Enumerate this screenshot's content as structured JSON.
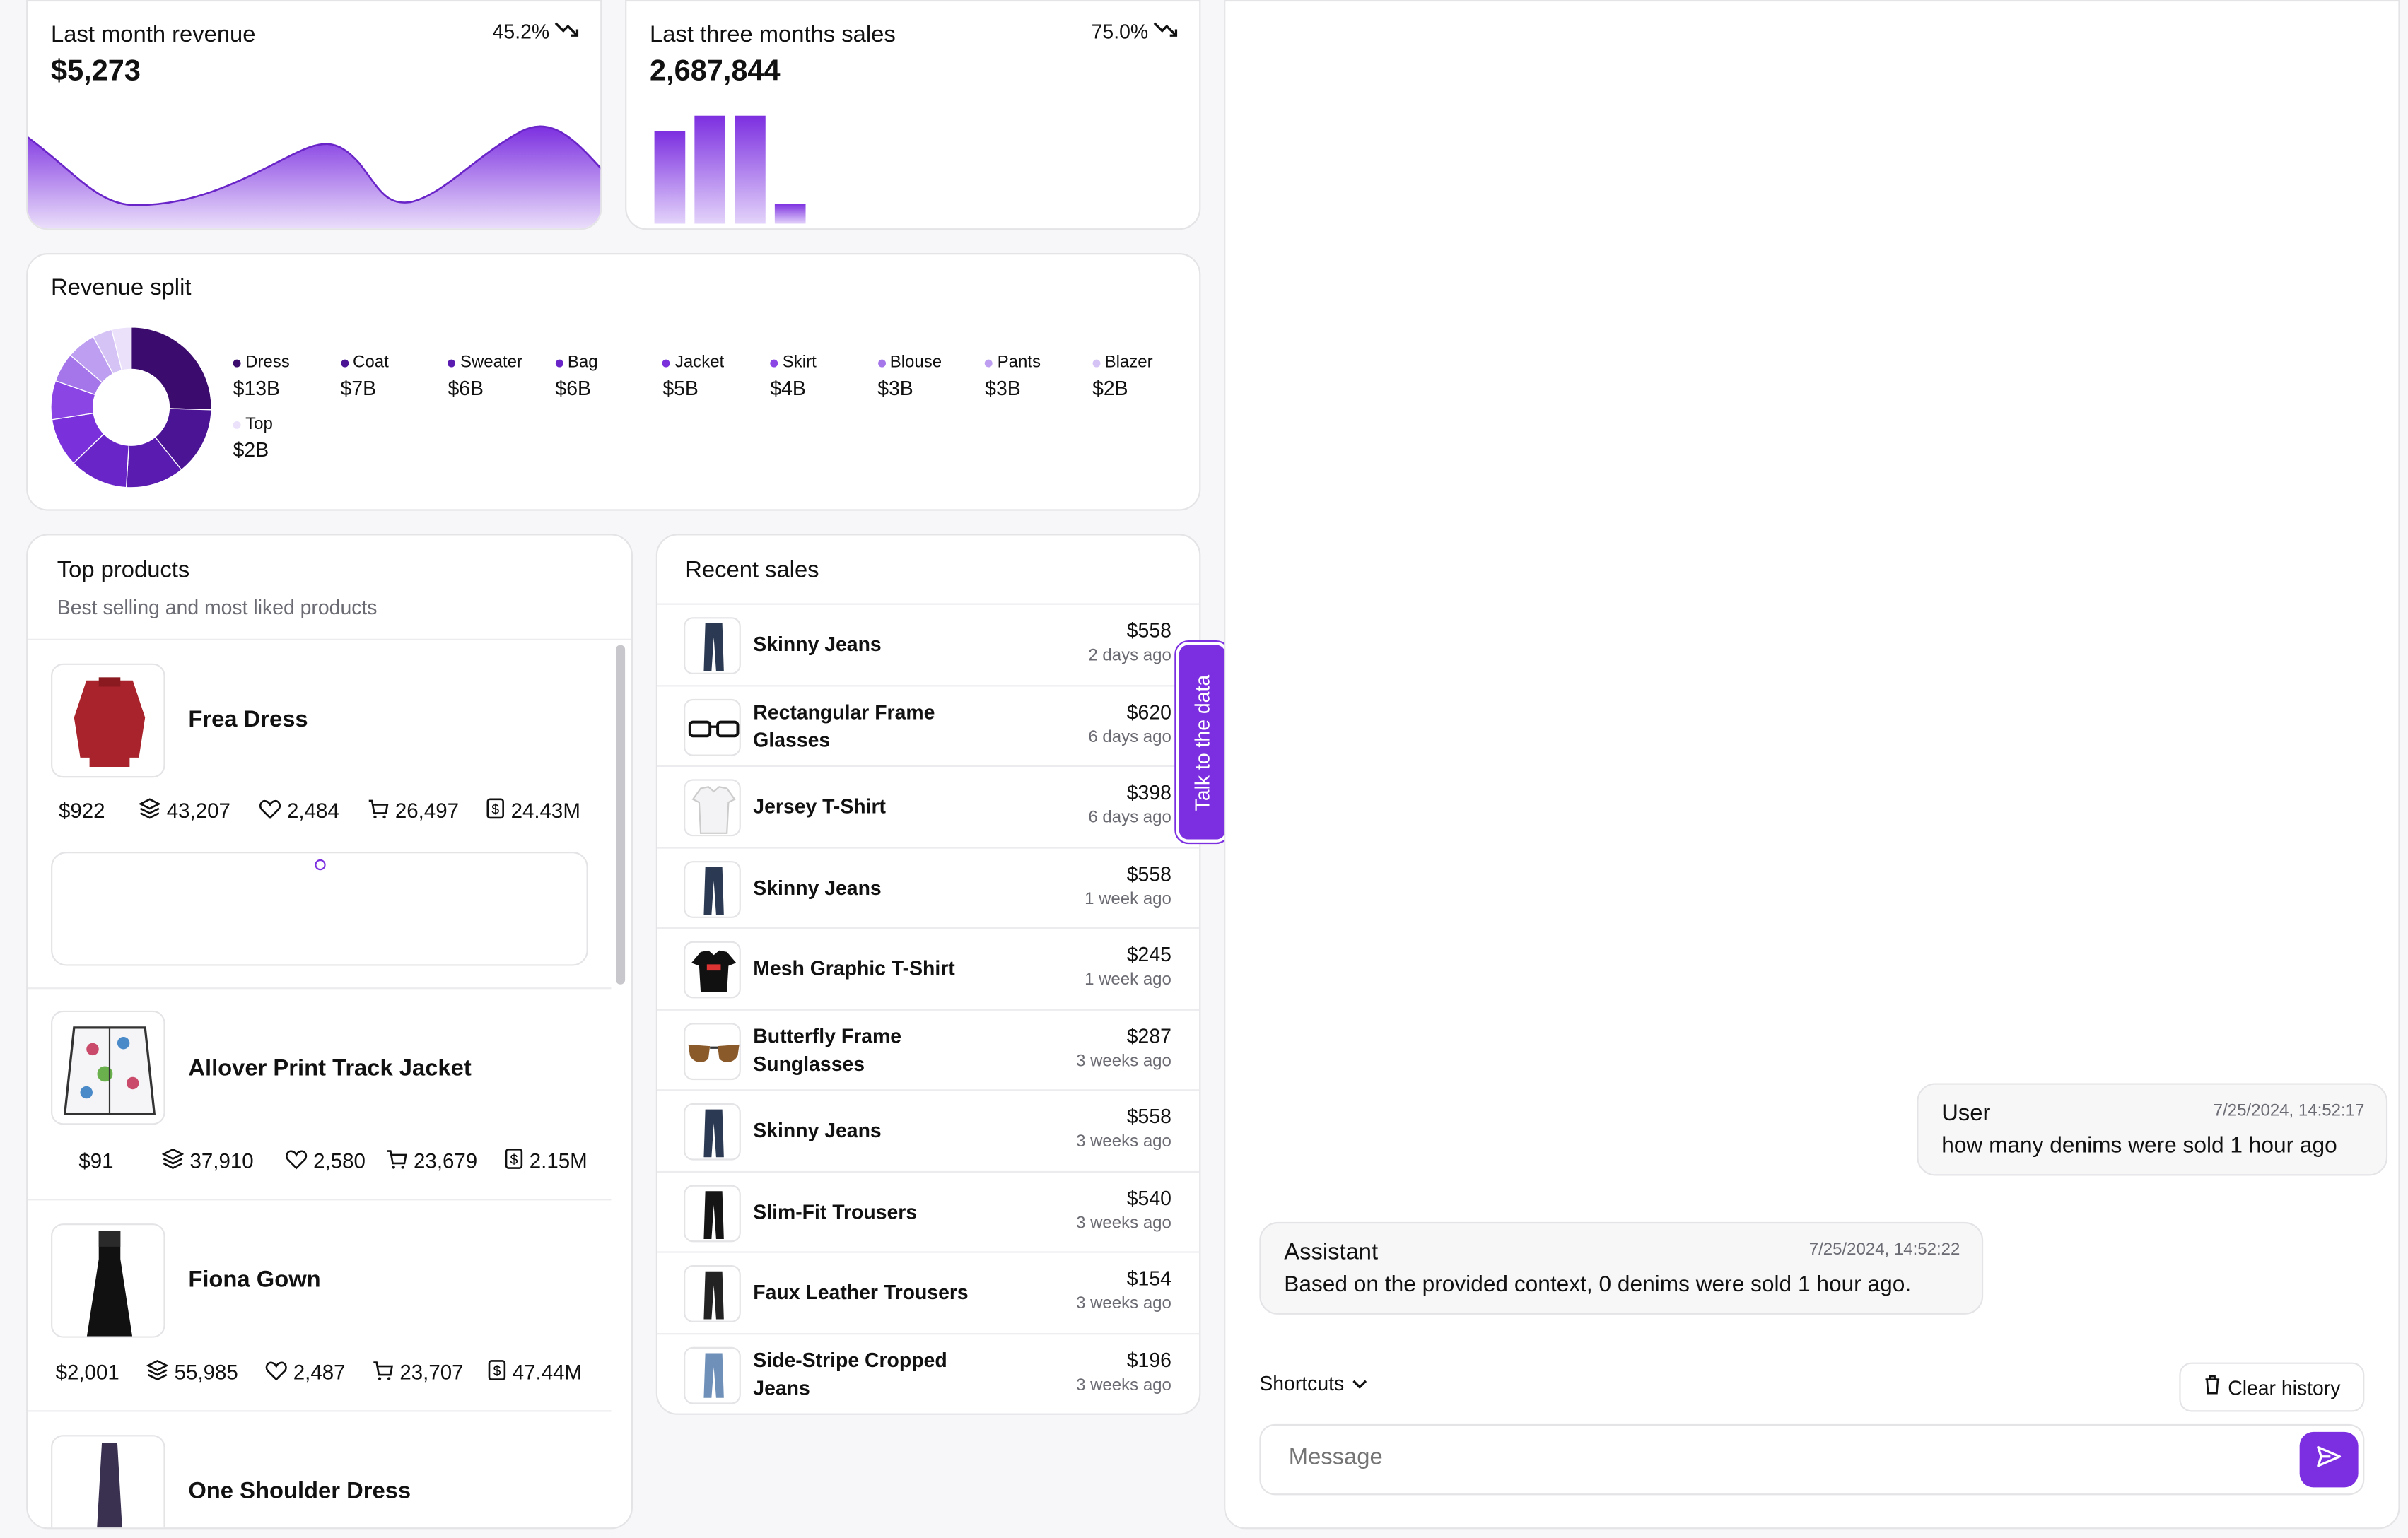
{
  "kpis": [
    {
      "title": "Last month revenue",
      "value": "$5,273",
      "pct": "45.2%"
    },
    {
      "title": "Last three months sales",
      "value": "2,687,844",
      "pct": "75.0%"
    }
  ],
  "revenue_split": {
    "title": "Revenue split",
    "items": [
      {
        "label": "Dress",
        "value": "$13B",
        "color": "#3b0c6e"
      },
      {
        "label": "Coat",
        "value": "$7B",
        "color": "#4a1495"
      },
      {
        "label": "Sweater",
        "value": "$6B",
        "color": "#5a1cb0"
      },
      {
        "label": "Bag",
        "value": "$6B",
        "color": "#6a25c8"
      },
      {
        "label": "Jacket",
        "value": "$5B",
        "color": "#7a31dc"
      },
      {
        "label": "Skirt",
        "value": "$4B",
        "color": "#8a45e4"
      },
      {
        "label": "Blouse",
        "value": "$3B",
        "color": "#a476ea"
      },
      {
        "label": "Pants",
        "value": "$3B",
        "color": "#bd9ef0"
      },
      {
        "label": "Blazer",
        "value": "$2B",
        "color": "#d5c3f6"
      },
      {
        "label": "Top",
        "value": "$2B",
        "color": "#ebe1fb"
      }
    ]
  },
  "top_products": {
    "title": "Top products",
    "subtitle": "Best selling and most liked products",
    "items": [
      {
        "name": "Frea Dress",
        "price": "$922",
        "stock": "43,207",
        "likes": "2,484",
        "orders": "26,497",
        "revenue": "24.43M"
      },
      {
        "name": "Allover Print Track Jacket",
        "price": "$91",
        "stock": "37,910",
        "likes": "2,580",
        "orders": "23,679",
        "revenue": "2.15M"
      },
      {
        "name": "Fiona Gown",
        "price": "$2,001",
        "stock": "55,985",
        "likes": "2,487",
        "orders": "23,707",
        "revenue": "47.44M"
      },
      {
        "name": "One Shoulder Dress"
      }
    ]
  },
  "recent_sales": {
    "title": "Recent sales",
    "items": [
      {
        "name": "Skinny Jeans",
        "amount": "$558",
        "ago": "2 days ago"
      },
      {
        "name": "Rectangular Frame Glasses",
        "amount": "$620",
        "ago": "6 days ago"
      },
      {
        "name": "Jersey T-Shirt",
        "amount": "$398",
        "ago": "6 days ago"
      },
      {
        "name": "Skinny Jeans",
        "amount": "$558",
        "ago": "1 week ago"
      },
      {
        "name": "Mesh Graphic T-Shirt",
        "amount": "$245",
        "ago": "1 week ago"
      },
      {
        "name": "Butterfly Frame Sunglasses",
        "amount": "$287",
        "ago": "3 weeks ago"
      },
      {
        "name": "Skinny Jeans",
        "amount": "$558",
        "ago": "3 weeks ago"
      },
      {
        "name": "Slim-Fit Trousers",
        "amount": "$540",
        "ago": "3 weeks ago"
      },
      {
        "name": "Faux Leather Trousers",
        "amount": "$154",
        "ago": "3 weeks ago"
      },
      {
        "name": "Side-Stripe Cropped Jeans",
        "amount": "$196",
        "ago": "3 weeks ago"
      }
    ]
  },
  "talk_tab": "Talk to the data",
  "chat": {
    "messages": [
      {
        "who": "User",
        "time": "7/25/2024, 14:52:17",
        "text": "how many denims were sold 1 hour ago"
      },
      {
        "who": "Assistant",
        "time": "7/25/2024, 14:52:22",
        "text": "Based on the provided context, 0 denims were sold 1 hour ago."
      }
    ],
    "shortcuts": "Shortcuts",
    "clear": "Clear history",
    "placeholder": "Message"
  },
  "accent": "#7c2fe0"
}
